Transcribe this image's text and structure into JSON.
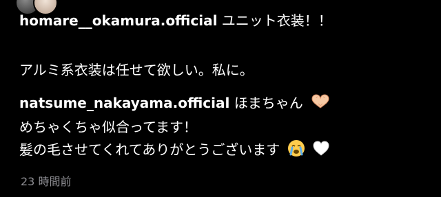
{
  "comments": [
    {
      "username": "homare__okamura.official",
      "line1": "ユニット衣装！！",
      "line2": "アルミ系衣装は任せて欲しい。私に。"
    },
    {
      "username": "natsume_nakayama.official",
      "line1": "ほまちゃん",
      "line2": "めちゃくちゃ似合ってます！",
      "line3": "髪の毛させてくれてありがとうございます",
      "emojis": [
        "heart-hands-icon",
        "crying-face-icon",
        "white-heart-icon"
      ]
    }
  ],
  "timestamp": "23 時間前",
  "colors": {
    "background": "#000000",
    "text": "#ffffff",
    "secondary_text": "#8e8e93"
  }
}
